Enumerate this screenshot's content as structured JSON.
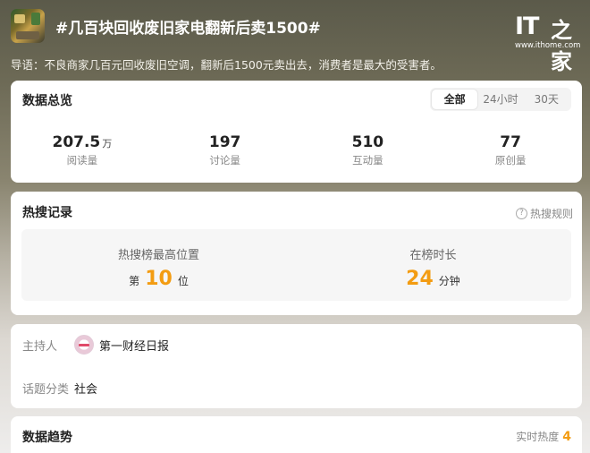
{
  "topic": {
    "title": "#几百块回收废旧家电翻新后卖1500#",
    "guide": "导语：不良商家几百元回收废旧空调，翻新后1500元卖出去，消费者是最大的受害者。"
  },
  "logo": {
    "it": "IT",
    "cn": "之家",
    "url": "www.ithome.com"
  },
  "overview": {
    "title": "数据总览",
    "tabs": [
      {
        "label": "全部",
        "active": true
      },
      {
        "label": "24小时",
        "active": false
      },
      {
        "label": "30天",
        "active": false
      }
    ],
    "stats": [
      {
        "value": "207.5",
        "unit": "万",
        "label": "阅读量"
      },
      {
        "value": "197",
        "unit": "",
        "label": "讨论量"
      },
      {
        "value": "510",
        "unit": "",
        "label": "互动量"
      },
      {
        "value": "77",
        "unit": "",
        "label": "原创量"
      }
    ]
  },
  "hot": {
    "title": "热搜记录",
    "rules_label": "热搜规则",
    "rules_icon": "question-circle-icon",
    "peak": {
      "label": "热搜榜最高位置",
      "prefix": "第",
      "value": "10",
      "suffix": "位"
    },
    "duration": {
      "label": "在榜时长",
      "value": "24",
      "suffix": "分钟"
    },
    "accent": "#f39c12"
  },
  "host": {
    "host_key": "主持人",
    "host_name": "第一财经日报",
    "host_avatar_icon": "media-avatar-icon",
    "category_key": "话题分类",
    "category_value": "社会"
  },
  "trend": {
    "title": "数据趋势",
    "realtime_label": "实时热度",
    "realtime_value": "4"
  }
}
